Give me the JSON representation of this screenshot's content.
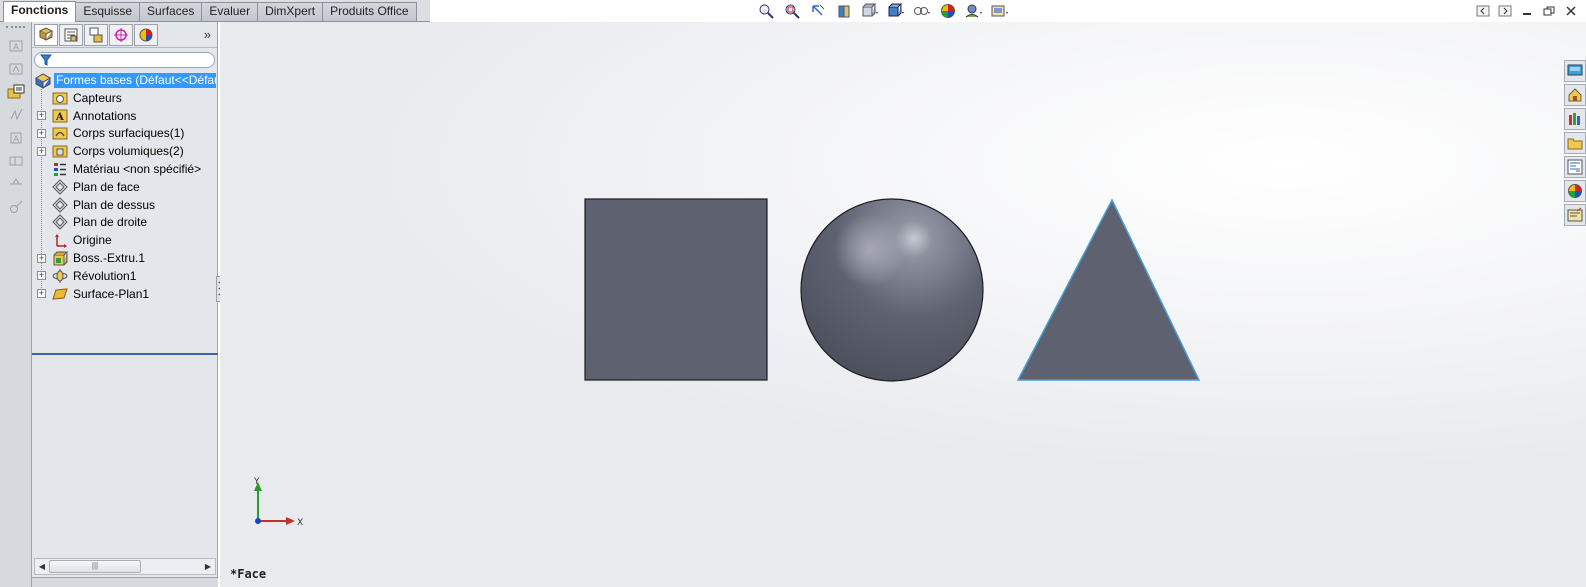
{
  "tabs": [
    {
      "label": "Fonctions",
      "active": true
    },
    {
      "label": "Esquisse",
      "active": false
    },
    {
      "label": "Surfaces",
      "active": false
    },
    {
      "label": "Evaluer",
      "active": false
    },
    {
      "label": "DimXpert",
      "active": false
    },
    {
      "label": "Produits Office",
      "active": false
    }
  ],
  "feature_tree": {
    "root": "Formes bases  (Défaut<<Défaut",
    "items": [
      {
        "label": "Capteurs",
        "expandable": false,
        "icon": "sensor-folder-icon"
      },
      {
        "label": "Annotations",
        "expandable": true,
        "icon": "annotations-folder-icon"
      },
      {
        "label": "Corps surfaciques(1)",
        "expandable": true,
        "icon": "surface-bodies-folder-icon"
      },
      {
        "label": "Corps volumiques(2)",
        "expandable": true,
        "icon": "solid-bodies-folder-icon"
      },
      {
        "label": "Matériau <non spécifié>",
        "expandable": false,
        "icon": "material-icon"
      },
      {
        "label": "Plan de face",
        "expandable": false,
        "icon": "plane-icon"
      },
      {
        "label": "Plan de dessus",
        "expandable": false,
        "icon": "plane-icon"
      },
      {
        "label": "Plan de droite",
        "expandable": false,
        "icon": "plane-icon"
      },
      {
        "label": "Origine",
        "expandable": false,
        "icon": "origin-icon"
      },
      {
        "label": "Boss.-Extru.1",
        "expandable": true,
        "icon": "extrude-icon"
      },
      {
        "label": "Révolution1",
        "expandable": true,
        "icon": "revolve-icon"
      },
      {
        "label": "Surface-Plan1",
        "expandable": true,
        "icon": "planar-surface-icon"
      }
    ]
  },
  "viewport": {
    "status_label": "*Face",
    "triad": {
      "y_label": "Y",
      "x_label": "X"
    },
    "shape_color": "#5e6170",
    "triangle_edge_color": "#4a9fd4"
  },
  "colors": {
    "selection": "#3399ff",
    "panel_bg": "#e3e6ea"
  }
}
